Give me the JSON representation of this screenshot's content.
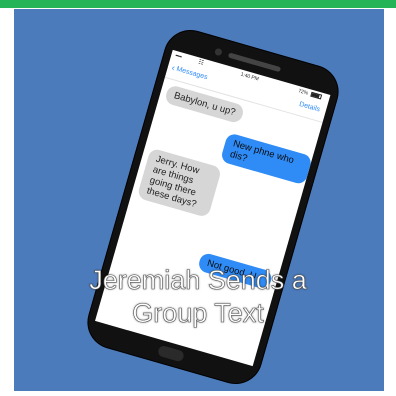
{
  "colors": {
    "top_bar": "#25b457",
    "background": "#4c7bbc",
    "phone_body": "#111111",
    "incoming_bubble": "#d6d6d6",
    "outgoing_bubble": "#2f8cf7",
    "caption_text": "#ffffff"
  },
  "phone": {
    "status_bar": {
      "signal": "•••••",
      "wifi_icon": "wifi-icon",
      "time": "1:40 PM",
      "battery": "72%",
      "battery_icon": "battery-icon"
    },
    "nav": {
      "back_icon": "chevron-left-icon",
      "back_label": "Messages",
      "details_label": "Details"
    },
    "messages": [
      {
        "direction": "incoming",
        "text": "Babylon, u up?"
      },
      {
        "direction": "outgoing",
        "text": "New phne who dis?"
      },
      {
        "direction": "incoming",
        "text": "Jerry. How are things going there these days?"
      },
      {
        "direction": "outgoing",
        "text": "Not good. U"
      }
    ]
  },
  "caption": {
    "line1": "Jeremiah Sends a",
    "line2": "Group Text"
  }
}
